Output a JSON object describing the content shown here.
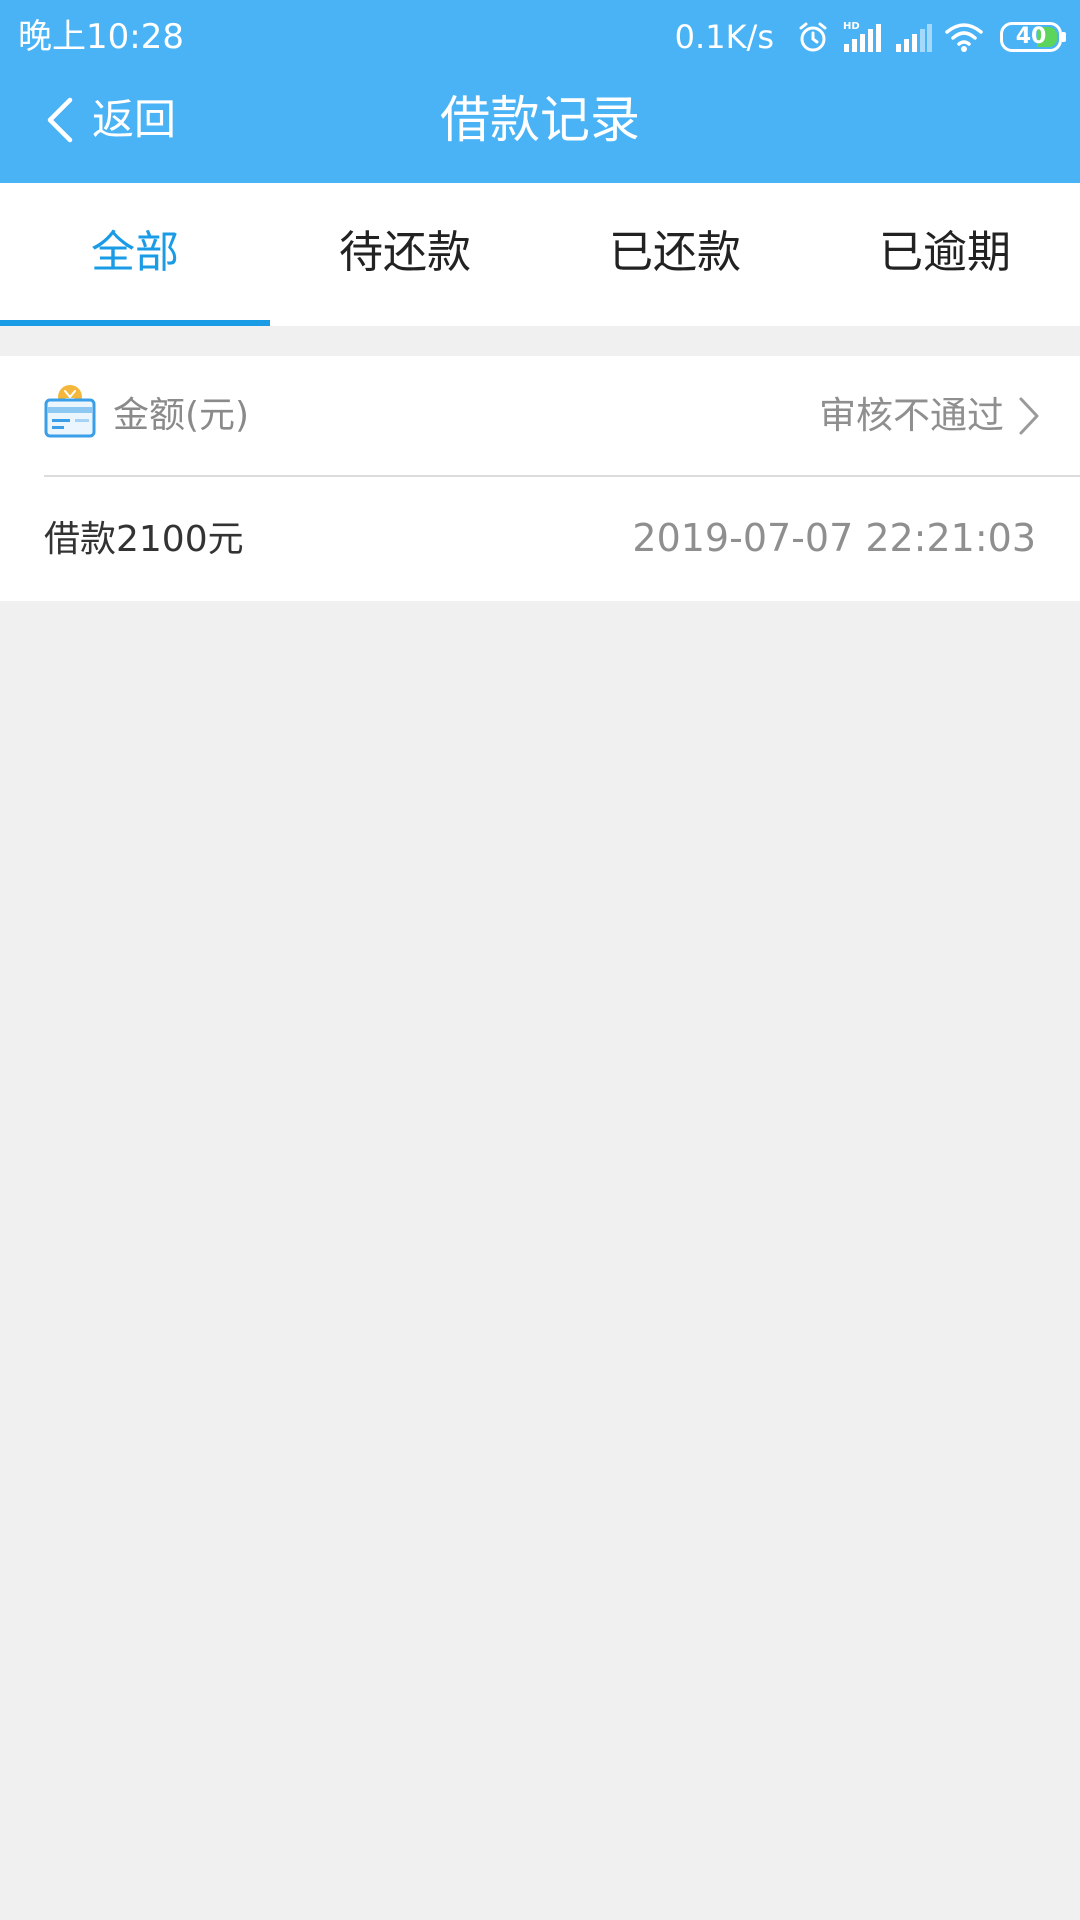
{
  "status_bar": {
    "time": "晚上10:28",
    "net_speed": "0.1K/s",
    "battery": "40",
    "icons": [
      "alarm-icon",
      "signal-hd-icon",
      "signal-icon",
      "wifi-icon",
      "battery-icon"
    ]
  },
  "nav": {
    "back_label": "返回",
    "title": "借款记录"
  },
  "tabs": [
    {
      "label": "全部",
      "active": true
    },
    {
      "label": "待还款",
      "active": false
    },
    {
      "label": "已还款",
      "active": false
    },
    {
      "label": "已逾期",
      "active": false
    }
  ],
  "record": {
    "amount_label": "金额(元)",
    "status": "审核不通过",
    "title": "借款2100元",
    "time": "2019-07-07 22:21:03"
  },
  "colors": {
    "header_bg": "#4ab3f6",
    "accent": "#1a9be6",
    "page_bg": "#f0f0f0"
  }
}
